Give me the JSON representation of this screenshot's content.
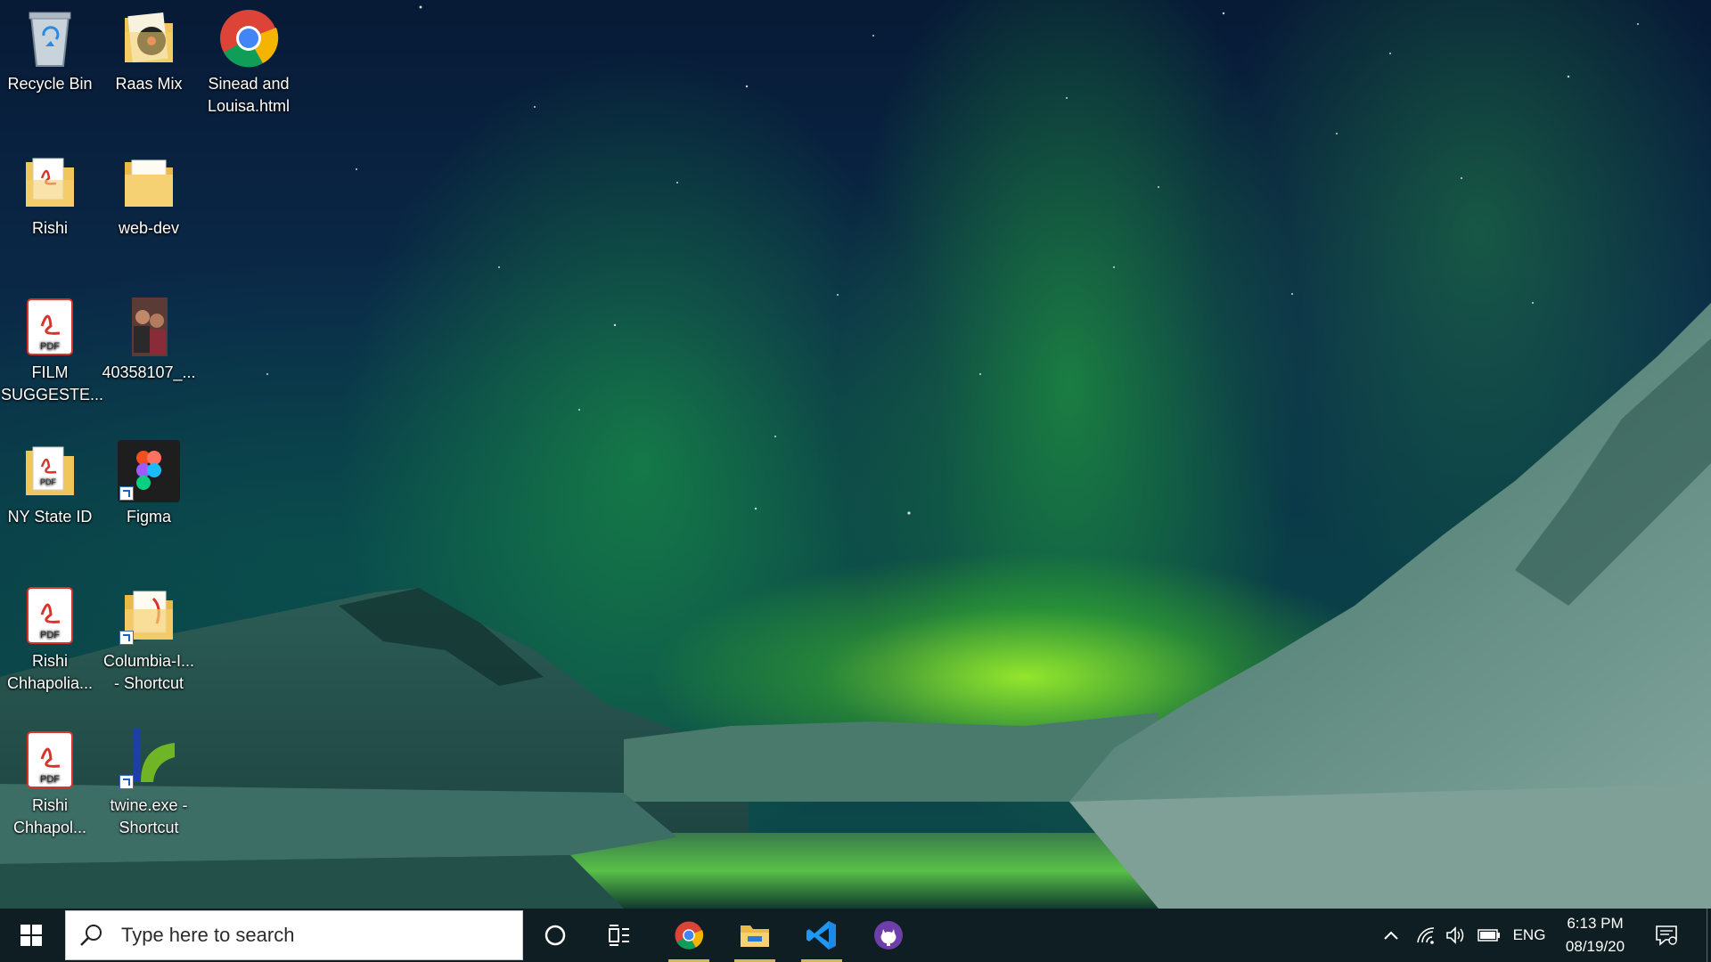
{
  "desktop": {
    "icons": [
      {
        "label": "Recycle Bin",
        "icon": "recycle-bin-icon"
      },
      {
        "label": "Raas Mix",
        "icon": "music-folder-icon"
      },
      {
        "label": "Sinead and Louisa.html",
        "icon": "chrome-icon"
      },
      {
        "label": "Rishi",
        "icon": "pdf-folder-icon"
      },
      {
        "label": "web-dev",
        "icon": "folder-icon"
      },
      {
        "label": "FILM SUGGESTE...",
        "icon": "pdf-icon"
      },
      {
        "label": "40358107_...",
        "icon": "photo-icon"
      },
      {
        "label": "NY State ID",
        "icon": "pdf-folder-icon"
      },
      {
        "label": "Figma",
        "icon": "figma-icon"
      },
      {
        "label": "Rishi Chhapolia...",
        "icon": "pdf-icon"
      },
      {
        "label": "Columbia-I... - Shortcut",
        "icon": "folder-shortcut-icon"
      },
      {
        "label": "Rishi Chhapol...",
        "icon": "pdf-icon"
      },
      {
        "label": "twine.exe - Shortcut",
        "icon": "twine-icon"
      }
    ]
  },
  "taskbar": {
    "search_placeholder": "Type here to search",
    "pinned_apps": [
      "chrome-icon",
      "file-explorer-icon",
      "vscode-icon",
      "github-desktop-icon"
    ],
    "tray": {
      "language": "ENG",
      "time": "6:13 PM",
      "date": "08/19/20"
    },
    "accent_color": "#d4b45a"
  }
}
